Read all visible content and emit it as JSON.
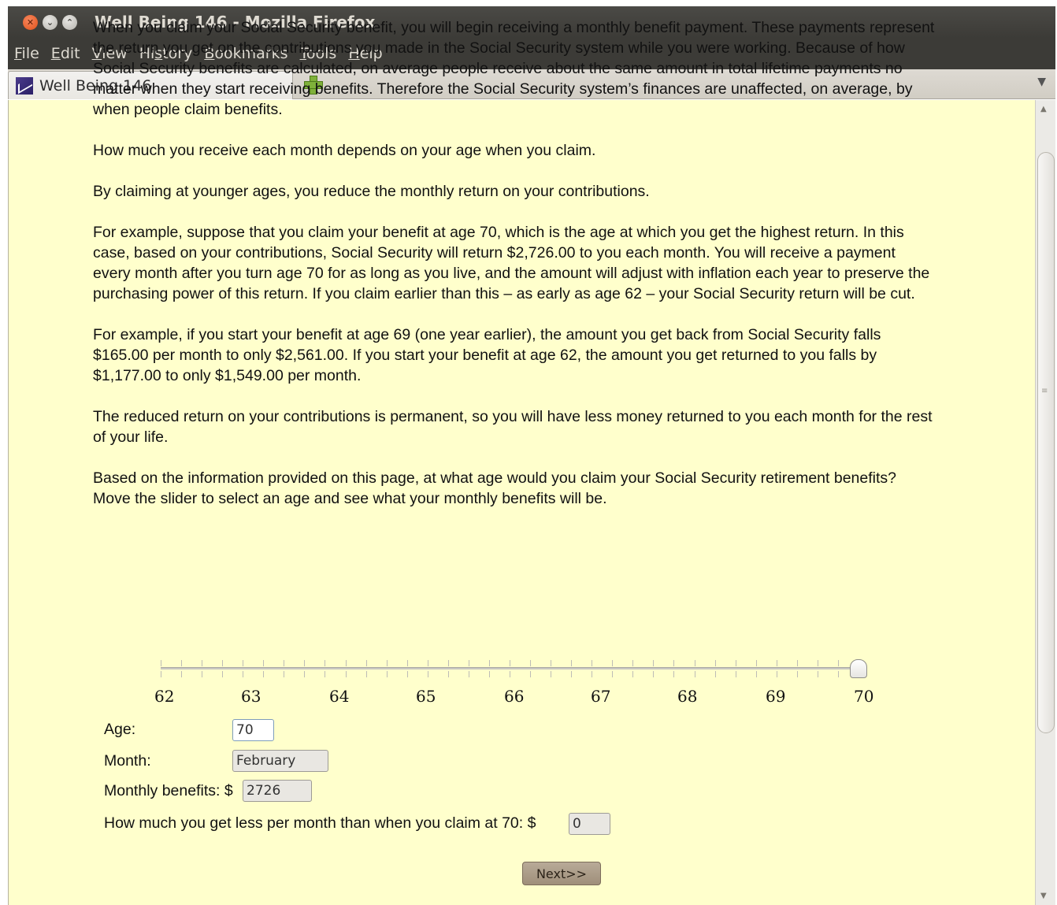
{
  "window": {
    "title": "Well Being 146 - Mozilla Firefox",
    "close_glyph": "✕",
    "min_glyph": "⌄",
    "max_glyph": "⌃"
  },
  "menu": {
    "items": [
      {
        "accel": "F",
        "rest": "ile"
      },
      {
        "accel": "E",
        "rest": "dit"
      },
      {
        "accel": "V",
        "rest": "iew"
      },
      {
        "pre": "Hi",
        "accel": "s",
        "rest": "tory"
      },
      {
        "accel": "B",
        "rest": "ookmarks"
      },
      {
        "accel": "T",
        "rest": "ools"
      },
      {
        "accel": "H",
        "rest": "elp"
      }
    ]
  },
  "tabs": {
    "active_tab_title": "Well Being 146",
    "favicon": "rand-logo-icon",
    "new_tab_icon": "plus-icon",
    "list_all_arrow": "▼"
  },
  "content": {
    "paragraphs": [
      "When you claim your Social Security benefit, you will begin receiving a monthly benefit payment. These payments represent the return you get on the contributions you made in the Social Security system while you were working. Because of how Social Security benefits are calculated, on average people receive about the same amount in total lifetime payments no matter when they start receiving benefits. Therefore the Social Security system’s finances are unaffected, on average, by when people claim benefits.",
      "How much you receive each month depends on your age when you claim.",
      "By claiming at younger ages, you reduce the monthly return on your contributions.",
      "For example, suppose that you claim your benefit at age 70, which is the age at which you get the highest return. In this case, based on your contributions, Social Security will return $2,726.00 to you each month. You will receive a payment every month after you turn age 70 for as long as you live, and the amount will adjust with inflation each year to preserve the purchasing power of this return. If you claim earlier than this – as early as age 62 – your Social Security return will be cut.",
      "For example, if you start your benefit at age 69 (one year earlier), the amount you get back from Social Security falls $165.00 per month to only $2,561.00. If you start your benefit at age 62, the amount you get returned to you falls by $1,177.00 to only $1,549.00 per month.",
      "The reduced return on your contributions is permanent, so you will have less money returned to you each month for the rest of your life.",
      "Based on the information provided on this page, at what age would you claim your Social Security retirement benefits? Move the slider to select an age and see what your monthly benefits will be."
    ]
  },
  "slider": {
    "labels": [
      "62",
      "63",
      "64",
      "65",
      "66",
      "67",
      "68",
      "69",
      "70"
    ],
    "min": 62,
    "max": 70,
    "value": 70
  },
  "form": {
    "age_label": "Age:",
    "age_value": "70",
    "month_label": "Month:",
    "month_value": "February",
    "benefits_label": "Monthly benefits: $",
    "benefits_value": "2726",
    "less_label": "How much you get less per month than when you claim at 70: $",
    "less_value": "0"
  },
  "next_button_label": "Next>>",
  "scrollbar": {
    "up_arrow": "▲",
    "down_arrow": "▼",
    "grip": "≡"
  }
}
